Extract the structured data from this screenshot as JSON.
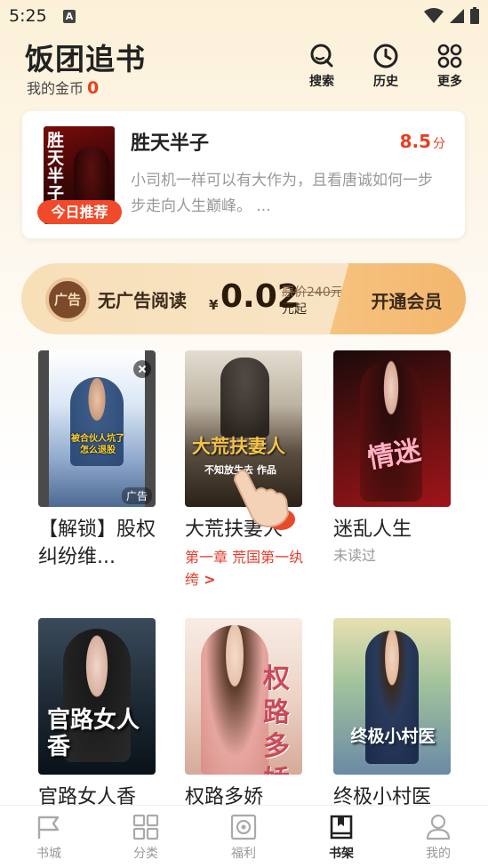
{
  "status_bar": {
    "time": "5:25",
    "a_badge": "A"
  },
  "header": {
    "app_title": "饭团追书",
    "coins_label": "我的金币",
    "coins_value": "0",
    "actions": [
      {
        "label": "搜索",
        "icon": "search-icon"
      },
      {
        "label": "历史",
        "icon": "clock-icon"
      },
      {
        "label": "更多",
        "icon": "grid-icon"
      }
    ]
  },
  "recommend": {
    "badge": "今日推荐",
    "title": "胜天半子",
    "score": "8.5",
    "score_unit": "分",
    "description": "小司机一样可以有大作为，且看唐诚如何一步步走向人生巅峰。 ...",
    "cover_text": "胜天半子"
  },
  "vip_banner": {
    "label": "无广告阅读",
    "icon_text": "广告",
    "currency": "¥",
    "price": "0.02",
    "original_price": "原价240元",
    "unit": "元起",
    "button": "开通会员"
  },
  "books": [
    {
      "title": "【解锁】股权纠纷维...",
      "subtitle": "",
      "ad_label": "广告",
      "cover_caption": "被合伙人坑了怎么退股",
      "colors": [
        "#c9d9ec",
        "#5b7fb6"
      ]
    },
    {
      "title": "大荒扶妻人",
      "subtitle": "第一章 荒国第一纨绔",
      "subtitle_arrow": ">",
      "cover_text": "大荒扶妻人",
      "cover_caption": "不知放生去 作品",
      "colors": [
        "#d8d0c0",
        "#3a3228"
      ]
    },
    {
      "title": "迷乱人生",
      "subtitle": "未读过",
      "cover_text": "情迷",
      "colors": [
        "#2a1010",
        "#8a1a1a"
      ]
    },
    {
      "title": "官路女人香",
      "cover_text": "官路女人香",
      "colors": [
        "#2a3a4a",
        "#0e1a24"
      ]
    },
    {
      "title": "权路多娇",
      "cover_text": "权路多娇",
      "colors": [
        "#f4e6dc",
        "#d8b6a4"
      ]
    },
    {
      "title": "终极小村医",
      "cover_text": "终极小村医",
      "colors": [
        "#a8c6a0",
        "#4a6a8a"
      ]
    }
  ],
  "bottom_nav": [
    {
      "label": "书城",
      "icon": "flag-icon",
      "active": false
    },
    {
      "label": "分类",
      "icon": "category-icon",
      "active": false
    },
    {
      "label": "福利",
      "icon": "welfare-icon",
      "active": false
    },
    {
      "label": "书架",
      "icon": "bookshelf-icon",
      "active": true
    },
    {
      "label": "我的",
      "icon": "profile-icon",
      "active": false
    }
  ]
}
